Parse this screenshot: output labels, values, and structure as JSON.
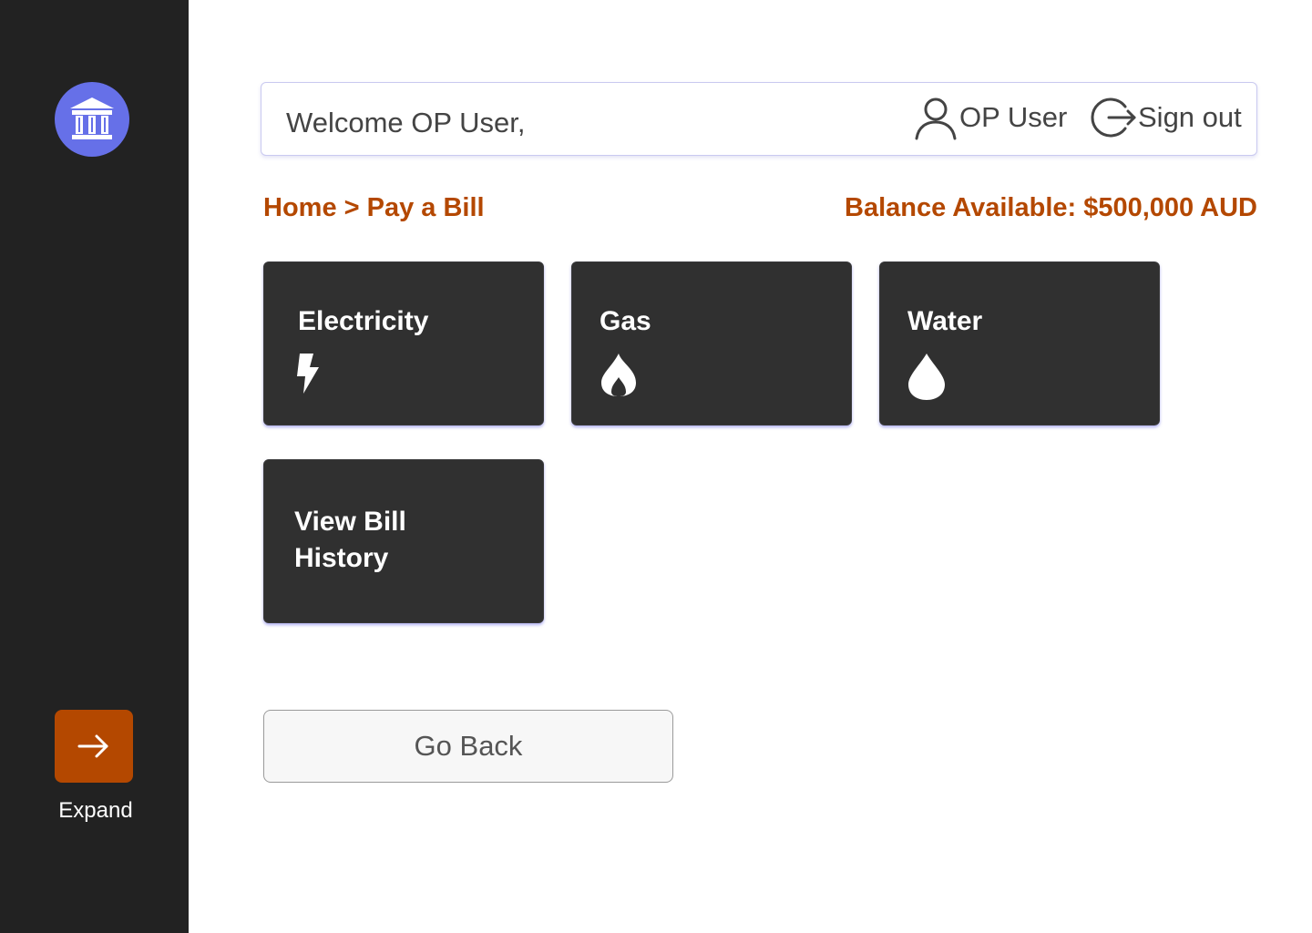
{
  "sidebar": {
    "logo_icon": "bank-icon",
    "expand_icon": "arrow-right-icon",
    "expand_label": "Expand"
  },
  "header": {
    "welcome": "Welcome OP User,",
    "user_label": "OP User",
    "user_icon": "user-icon",
    "signout_label": "Sign out",
    "signout_icon": "sign-out-icon"
  },
  "breadcrumb": {
    "home": "Home",
    "separator": ">",
    "current": "Pay a Bill"
  },
  "balance": "Balance Available: $500,000 AUD",
  "cards": [
    {
      "label": "Electricity",
      "icon": "lightning-icon"
    },
    {
      "label": "Gas",
      "icon": "flame-icon"
    },
    {
      "label": "Water",
      "icon": "water-drop-icon"
    },
    {
      "label": "View Bill History"
    }
  ],
  "actions": {
    "go_back": "Go Back"
  },
  "colors": {
    "sidebar_bg": "#222222",
    "accent": "#b44800",
    "logo_bg": "#6670e8",
    "card_bg": "#303030"
  }
}
